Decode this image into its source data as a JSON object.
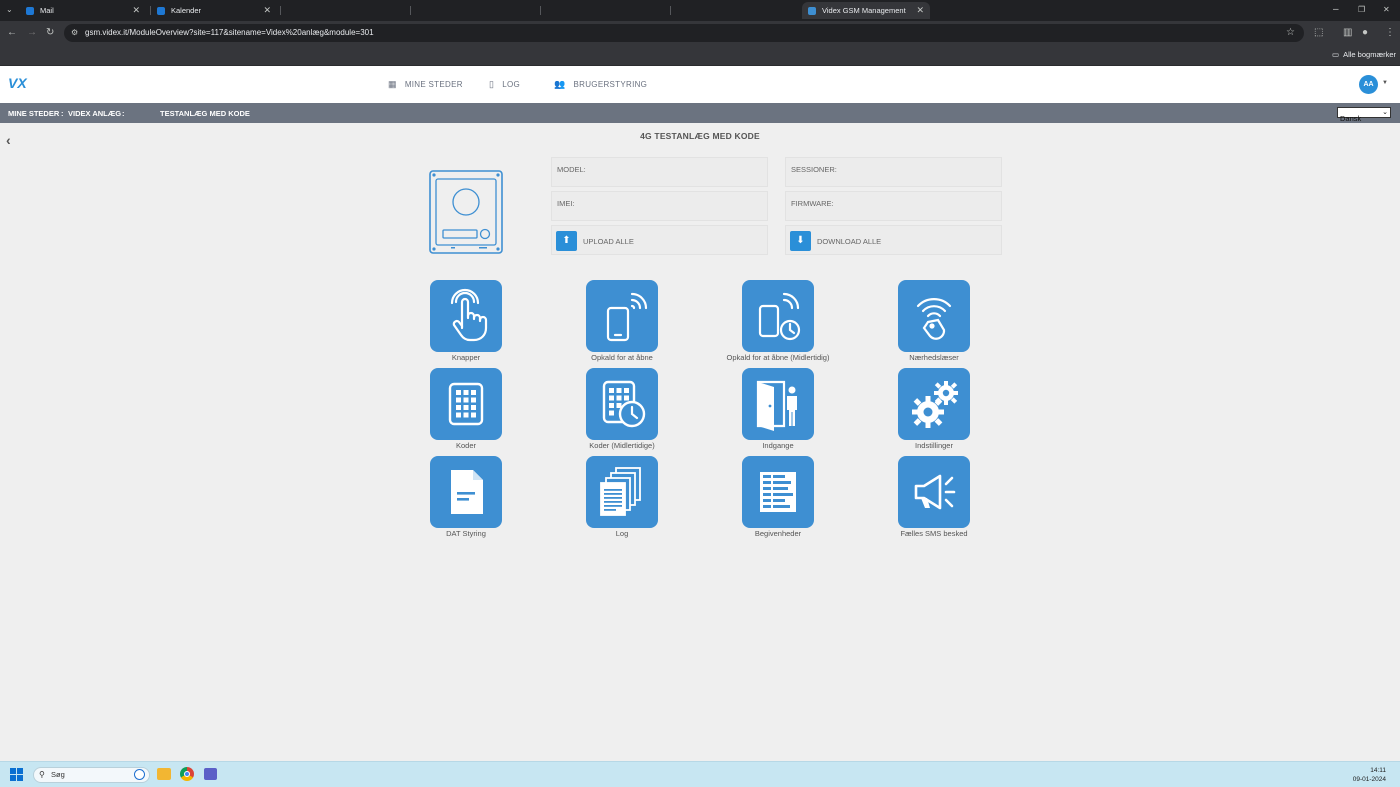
{
  "browser": {
    "tabs": [
      {
        "label": "Mail"
      },
      {
        "label": "Kalender"
      },
      {
        "label": "Videx GSM Management"
      }
    ],
    "url": "gsm.videx.it/ModuleOverview?site=117&sitename=Videx%20anlæg&module=301",
    "bookmarks_label": "Alle bogmærker"
  },
  "header": {
    "logo_text": "VX",
    "nav": [
      {
        "label": "MINE STEDER"
      },
      {
        "label": "LOG"
      },
      {
        "label": "BRUGERSTYRING"
      }
    ],
    "avatar_initials": "AA"
  },
  "breadcrumb": {
    "part1": "MINE STEDER",
    "sep1": ":",
    "part2": "VIDEX ANLÆG",
    "sep2": ":",
    "part3": "TESTANLÆG MED KODE",
    "language": "Dansk"
  },
  "page": {
    "title": "4G TESTANLÆG MED KODE",
    "info": {
      "model_label": "MODEL:",
      "sessions_label": "SESSIONER:",
      "imei_label": "IMEI:",
      "firmware_label": "FIRMWARE:",
      "upload_label": "UPLOAD ALLE",
      "download_label": "DOWNLOAD ALLE"
    },
    "modules": [
      {
        "label": "Knapper",
        "icon": "hand-pointer-icon"
      },
      {
        "label": "Opkald for at åbne",
        "icon": "phone-signal-icon"
      },
      {
        "label": "Opkald for at åbne (Midlertidig)",
        "icon": "phone-clock-icon"
      },
      {
        "label": "Nærhedslæser",
        "icon": "proximity-tag-icon"
      },
      {
        "label": "Koder",
        "icon": "keypad-icon"
      },
      {
        "label": "Koder (Midlertidige)",
        "icon": "keypad-clock-icon"
      },
      {
        "label": "Indgange",
        "icon": "door-person-icon"
      },
      {
        "label": "Indstillinger",
        "icon": "gears-icon"
      },
      {
        "label": "DAT Styring",
        "icon": "document-icon"
      },
      {
        "label": "Log",
        "icon": "stacked-pages-icon"
      },
      {
        "label": "Begivenheder",
        "icon": "event-list-icon"
      },
      {
        "label": "Fælles SMS besked",
        "icon": "megaphone-icon"
      }
    ]
  },
  "taskbar": {
    "search_placeholder": "Søg",
    "time": "14:11",
    "date": "09-01-2024"
  },
  "colors": {
    "accent": "#3e8fd2",
    "breadcrumb_bg": "#6b7380",
    "page_bg": "#efefef"
  }
}
